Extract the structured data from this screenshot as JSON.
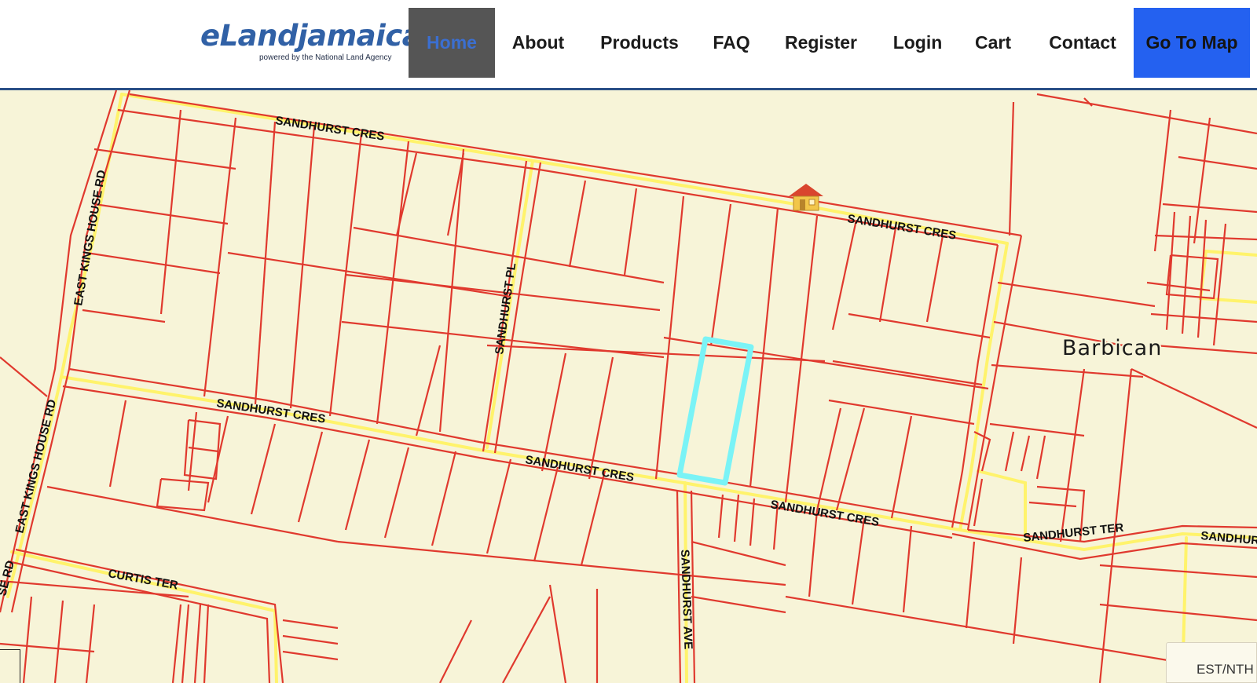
{
  "brand": {
    "name": "eLandjamaica",
    "tagline": "powered by the National Land Agency"
  },
  "nav": {
    "items": [
      {
        "label": "Home",
        "active": true
      },
      {
        "label": "About"
      },
      {
        "label": "Products"
      },
      {
        "label": "FAQ"
      },
      {
        "label": "Register"
      },
      {
        "label": "Login"
      },
      {
        "label": "Cart"
      },
      {
        "label": "Contact"
      }
    ],
    "cta_label": "Go To Map"
  },
  "map": {
    "place_label": "Barbican",
    "street_labels": [
      "SANDHURST CRES",
      "SANDHURST CRES",
      "SANDHURST CRES",
      "SANDHURST CRES",
      "SANDHURST CRES",
      "SANDHURST PL",
      "SANDHURST AVE",
      "SANDHURST TER",
      "SANDHUR",
      "EAST KINGS HOUSE RD",
      "EAST KINGS HOUSE RD",
      "SE RD",
      "CURTIS TER"
    ],
    "coordinate_readout": "EST/NTH",
    "colors": {
      "background": "#f7f4d8",
      "parcel_lines": "#e0392e",
      "road_center": "#fff36b",
      "selected_parcel": "#7af3f6"
    },
    "marker_icon": "house-icon"
  }
}
